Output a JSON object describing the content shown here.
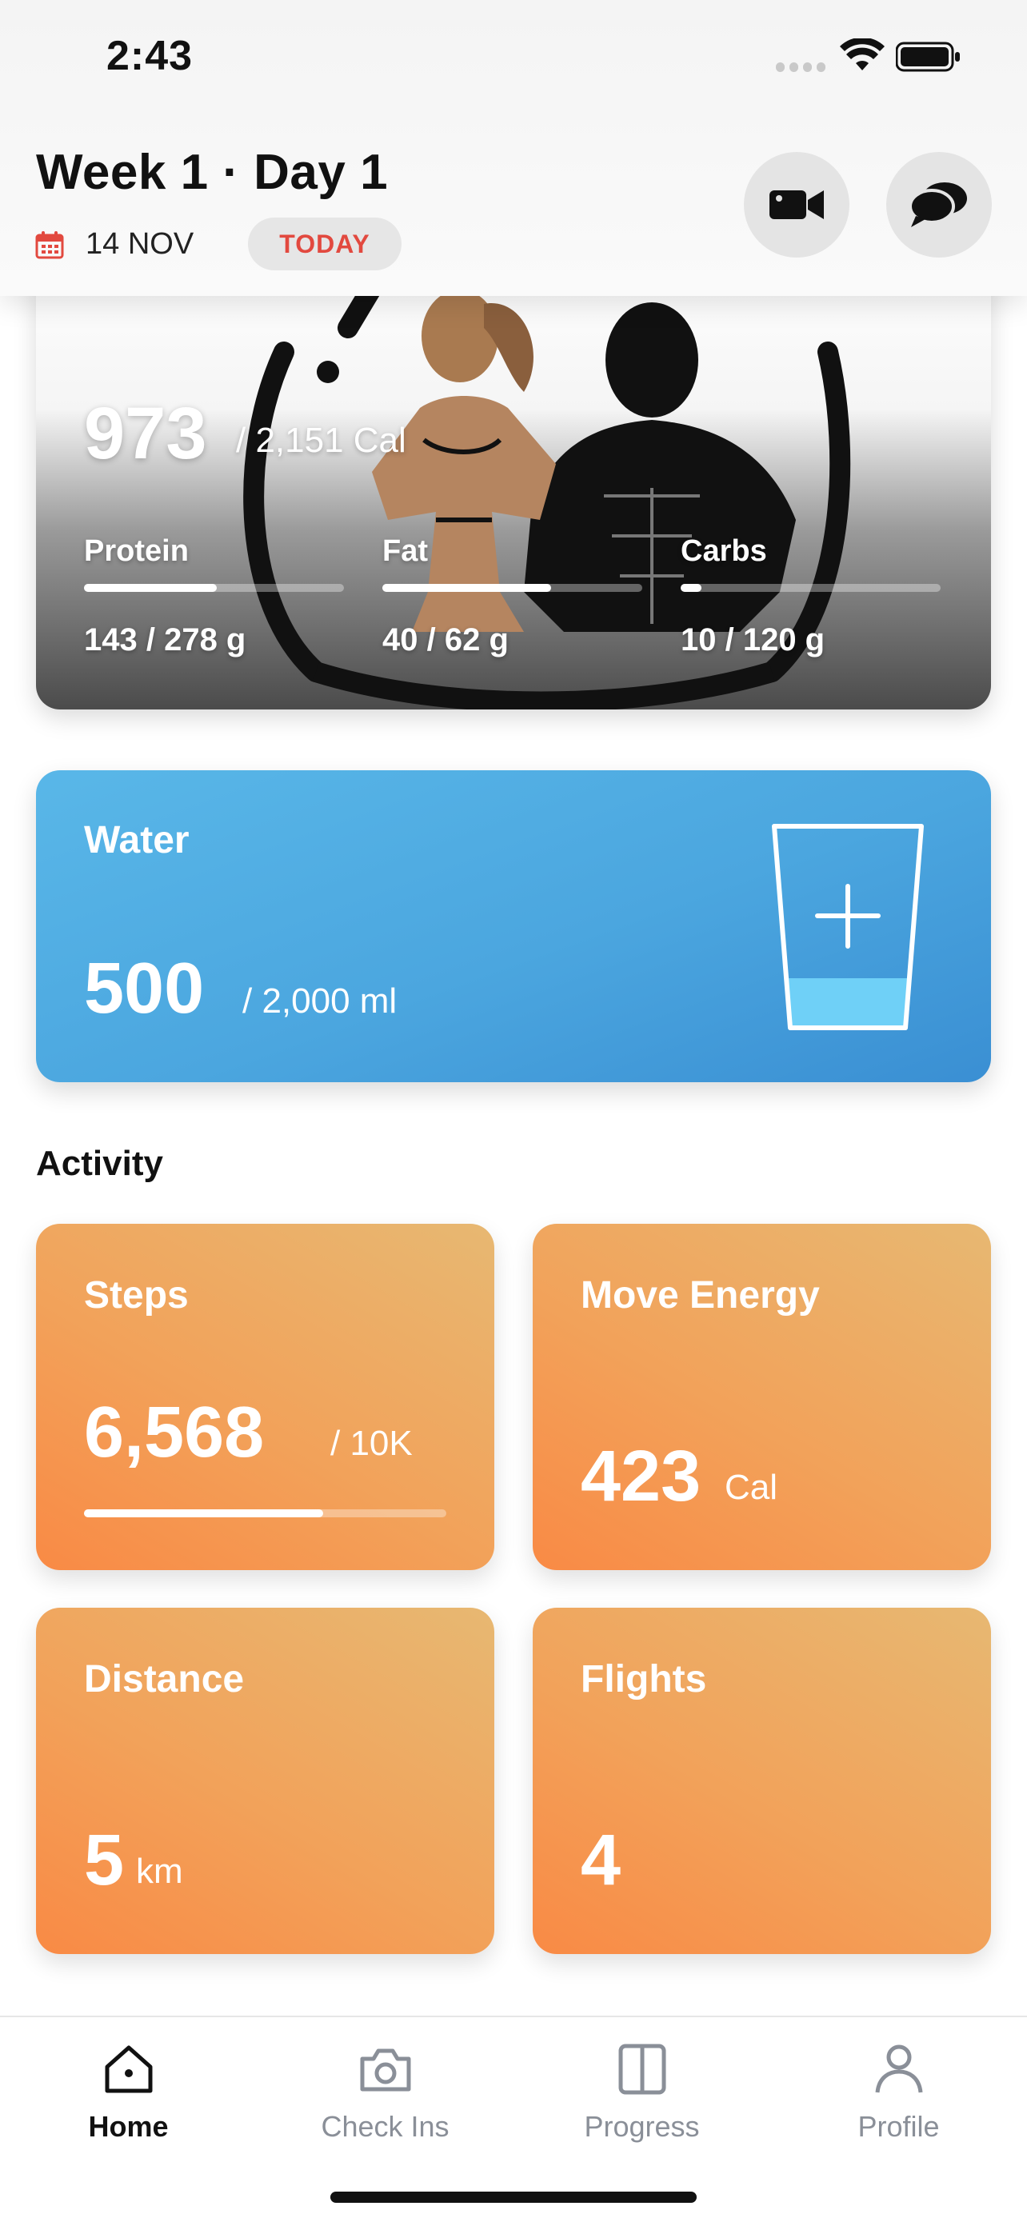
{
  "status_bar": {
    "time": "2:43"
  },
  "header": {
    "title": "Week 1 · Day 1",
    "date": "14 NOV",
    "today_label": "TODAY",
    "video_icon": "video-camera-icon",
    "chat_icon": "chat-bubbles-icon"
  },
  "macros": {
    "calories": "973",
    "calorie_goal": "/ 2,151 Cal",
    "items": [
      {
        "label": "Protein",
        "amount": "143 / 278 g",
        "progress": 0.51
      },
      {
        "label": "Fat",
        "amount": "40 / 62 g",
        "progress": 0.65
      },
      {
        "label": "Carbs",
        "amount": "10 / 120 g",
        "progress": 0.08
      }
    ]
  },
  "water": {
    "title": "Water",
    "value": "500",
    "goal": "/  2,000 ml",
    "icon": "water-glass-plus-icon"
  },
  "activity": {
    "heading": "Activity",
    "steps": {
      "title": "Steps",
      "value": "6,568",
      "unit": "/ 10K",
      "progress": 0.66
    },
    "move_energy": {
      "title": "Move Energy",
      "value": "423",
      "unit": "Cal"
    },
    "distance": {
      "title": "Distance",
      "value": "5",
      "unit": "km"
    },
    "flights": {
      "title": "Flights",
      "value": "4"
    }
  },
  "tabbar": {
    "items": [
      {
        "label": "Home",
        "icon": "home-icon",
        "active": true
      },
      {
        "label": "Check Ins",
        "icon": "camera-icon",
        "active": false
      },
      {
        "label": "Progress",
        "icon": "split-panel-icon",
        "active": false
      },
      {
        "label": "Profile",
        "icon": "person-icon",
        "active": false
      }
    ]
  },
  "colors": {
    "accent_red": "#e2493f",
    "water_blue": "#4ba6df",
    "activity_orange": "#f2a25a"
  }
}
